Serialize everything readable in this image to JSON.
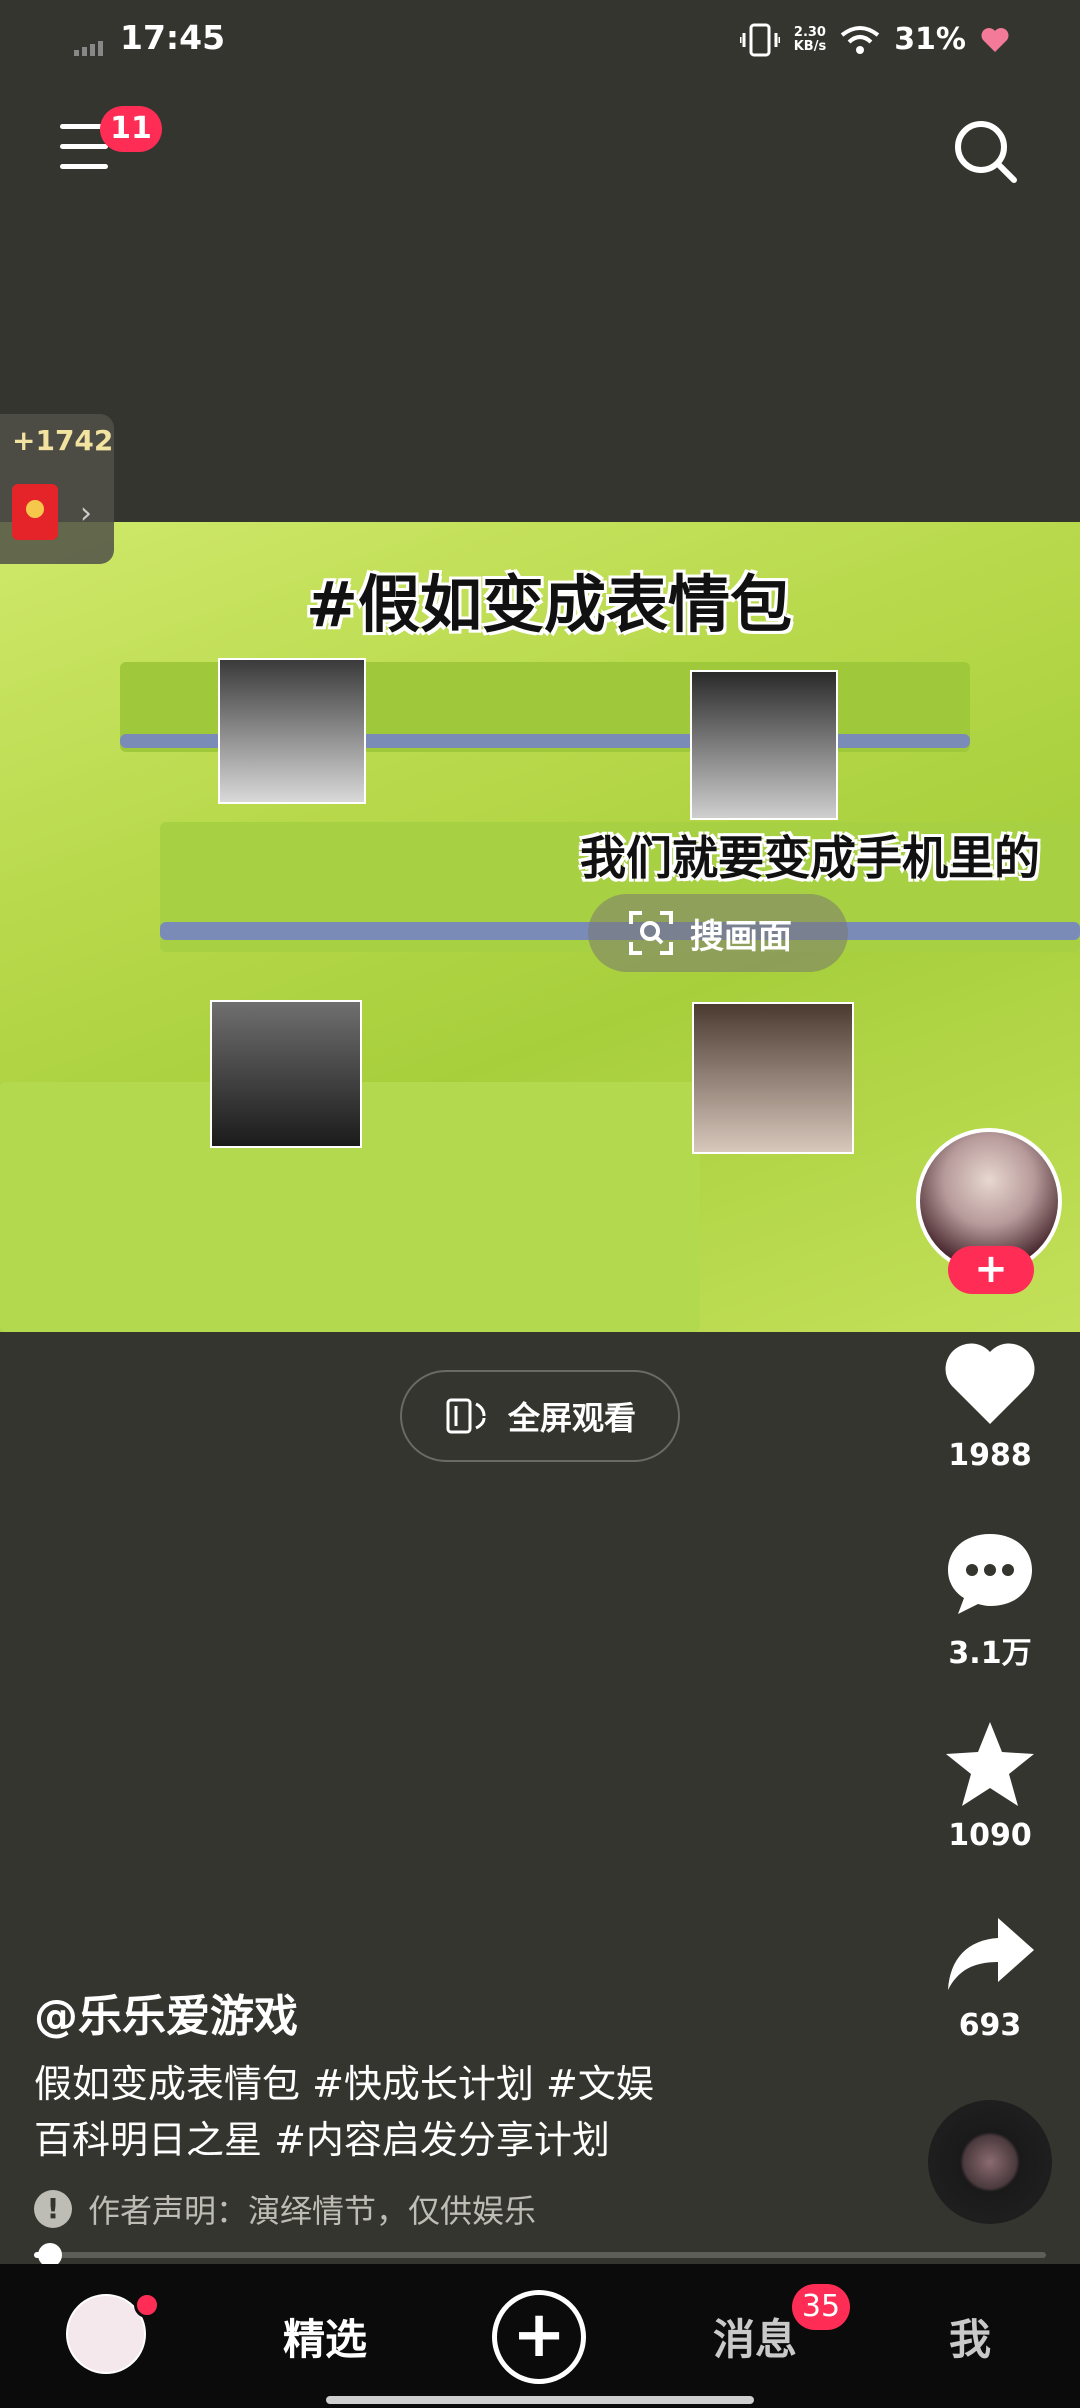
{
  "status": {
    "time": "17:45",
    "net_speed_value": "2.30",
    "net_speed_unit": "KB/s",
    "battery": "31%"
  },
  "header": {
    "menu_badge": "11"
  },
  "coin_widget": {
    "value": "+1742",
    "arrow": "›"
  },
  "video": {
    "title_overlay": "#假如变成表情包",
    "subtitle_overlay": "我们就要变成手机里的",
    "search_pill": "搜画面"
  },
  "fullscreen_button": "全屏观看",
  "rail": {
    "follow": "+",
    "likes": "1988",
    "comments": "3.1万",
    "favorites": "1090",
    "shares": "693"
  },
  "caption": {
    "author": "@乐乐爱游戏",
    "line1": "假如变成表情包 #快成长计划 #文娱",
    "line2": "百科明日之星 #内容启发分享计划",
    "notice": "作者声明：演绎情节，仅供娱乐",
    "notice_icon": "!"
  },
  "progress": {
    "fraction": 0.016
  },
  "nav": {
    "featured": "精选",
    "plus": "+",
    "messages": "消息",
    "messages_badge": "35",
    "me": "我"
  },
  "colors": {
    "accent": "#ff2d55",
    "background": "#35352f",
    "nav_bg": "#0b0b0b"
  }
}
